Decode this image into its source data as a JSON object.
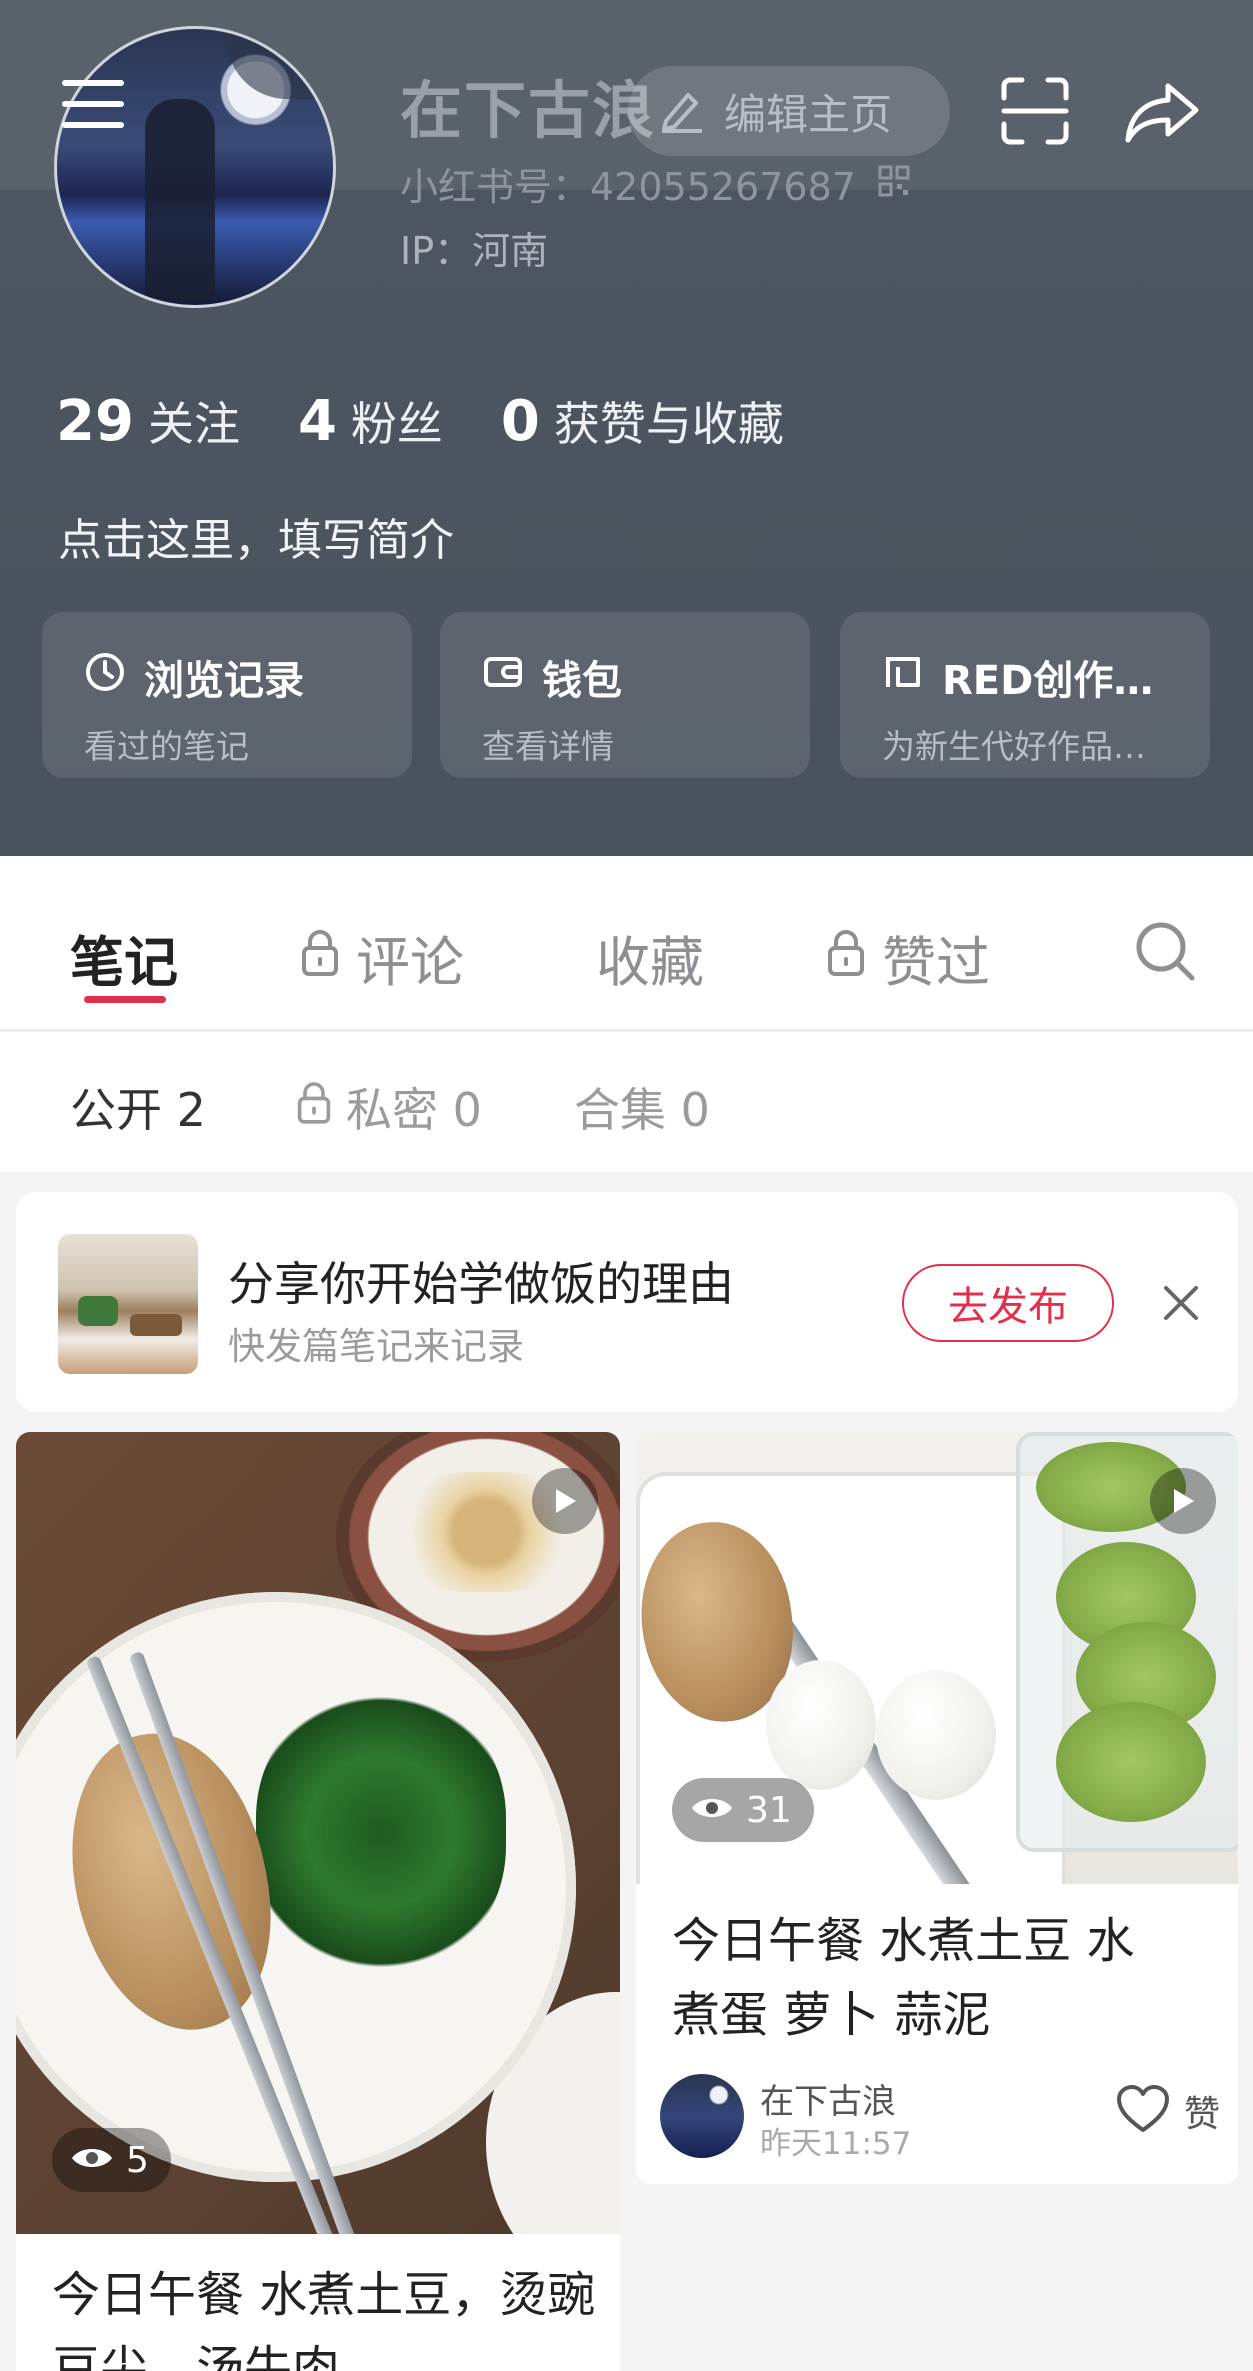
{
  "profile": {
    "username": "在下古浪",
    "edit_label": "编辑主页",
    "red_id": "小红书号：42055267687",
    "ip": "IP：河南",
    "stats": [
      {
        "num": "29",
        "label": "关注"
      },
      {
        "num": "4",
        "label": "粉丝"
      },
      {
        "num": "0",
        "label": "获赞与收藏"
      }
    ],
    "bio": "点击这里，填写简介",
    "quick_cards": [
      {
        "title": "浏览记录",
        "subtitle": "看过的笔记",
        "icon": "history-icon"
      },
      {
        "title": "钱包",
        "subtitle": "查看详情",
        "icon": "wallet-icon"
      },
      {
        "title": "RED创作…",
        "subtitle": "为新生代好作品…",
        "icon": "creator-icon"
      }
    ]
  },
  "tabs": [
    {
      "label": "笔记",
      "locked": false,
      "active": true
    },
    {
      "label": "评论",
      "locked": true,
      "active": false
    },
    {
      "label": "收藏",
      "locked": false,
      "active": false
    },
    {
      "label": "赞过",
      "locked": true,
      "active": false
    }
  ],
  "subtabs": [
    {
      "label": "公开 2",
      "locked": false,
      "active": true
    },
    {
      "label": "私密 0",
      "locked": true,
      "active": false
    },
    {
      "label": "合集 0",
      "locked": false,
      "active": false
    }
  ],
  "promo": {
    "title": "分享你开始学做饭的理由",
    "subtitle": "快发篇笔记来记录",
    "button": "去发布"
  },
  "feed": [
    {
      "title": "今日午餐 水煮土豆，烫豌豆尖，汤牛肉",
      "views": "5",
      "is_video": true
    },
    {
      "title_line1": "今日午餐 水煮土豆 水",
      "title_line2": "煮蛋 萝卜 蒜泥",
      "views": "31",
      "is_video": true,
      "author": "在下古浪",
      "time": "昨天11:57",
      "like_label": "赞"
    }
  ],
  "colors": {
    "header_bg": "#4e5661",
    "accent_red": "#e0304b",
    "page_bg": "#f4f4f5"
  }
}
